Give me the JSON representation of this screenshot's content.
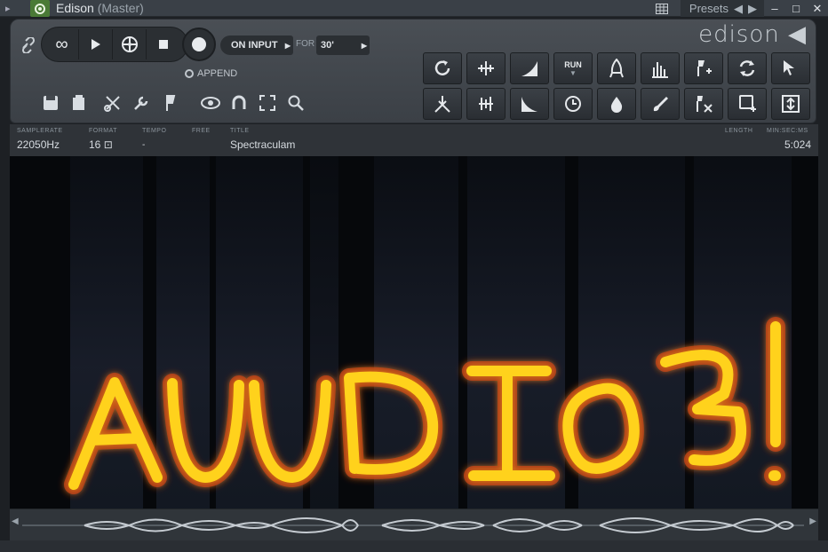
{
  "window": {
    "title": "Edison",
    "subtitle": "(Master)",
    "presets_label": "Presets"
  },
  "logo": "edison",
  "transport": {
    "on_input_label": "ON INPUT",
    "for_label": "FOR",
    "seconds_value": "30'",
    "append_label": "APPEND"
  },
  "info": {
    "samplerate_label": "SAMPLERATE",
    "samplerate_value": "22050Hz",
    "format_label": "FORMAT",
    "format_value": "16",
    "tempo_label": "TEMPO",
    "tempo_value": "-",
    "free_label": "FREE",
    "title_label": "TITLE",
    "title_value": "Spectraculam",
    "length_label": "LENGTH",
    "minsec_label": "MIN:SEC:MS",
    "length_value": "5:024"
  },
  "grid_buttons": [
    "reverse",
    "normalize",
    "fade-in",
    "run",
    "rocket",
    "spectrum",
    "marker-add",
    "loop",
    "cursor",
    "blend",
    "eq",
    "fade-out",
    "clock",
    "drop",
    "brush",
    "region",
    "save-region",
    "fit"
  ],
  "run_label": "RUN",
  "spectrogram": {
    "text": "AUUDI03!",
    "glow_color": "#ffd21a"
  },
  "colors": {
    "accent_green": "#4a7a36",
    "panel": "#43484e"
  }
}
